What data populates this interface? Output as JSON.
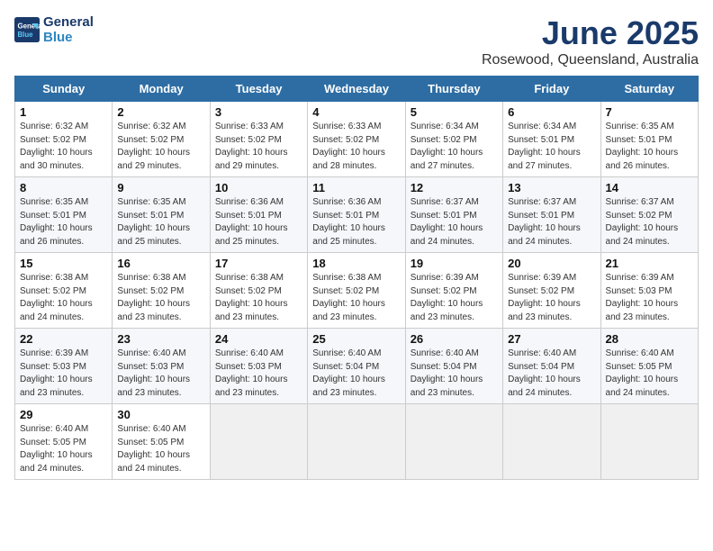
{
  "header": {
    "logo_line1": "General",
    "logo_line2": "Blue",
    "month": "June 2025",
    "location": "Rosewood, Queensland, Australia"
  },
  "weekdays": [
    "Sunday",
    "Monday",
    "Tuesday",
    "Wednesday",
    "Thursday",
    "Friday",
    "Saturday"
  ],
  "weeks": [
    [
      {
        "day": "1",
        "detail": "Sunrise: 6:32 AM\nSunset: 5:02 PM\nDaylight: 10 hours\nand 30 minutes."
      },
      {
        "day": "2",
        "detail": "Sunrise: 6:32 AM\nSunset: 5:02 PM\nDaylight: 10 hours\nand 29 minutes."
      },
      {
        "day": "3",
        "detail": "Sunrise: 6:33 AM\nSunset: 5:02 PM\nDaylight: 10 hours\nand 29 minutes."
      },
      {
        "day": "4",
        "detail": "Sunrise: 6:33 AM\nSunset: 5:02 PM\nDaylight: 10 hours\nand 28 minutes."
      },
      {
        "day": "5",
        "detail": "Sunrise: 6:34 AM\nSunset: 5:02 PM\nDaylight: 10 hours\nand 27 minutes."
      },
      {
        "day": "6",
        "detail": "Sunrise: 6:34 AM\nSunset: 5:01 PM\nDaylight: 10 hours\nand 27 minutes."
      },
      {
        "day": "7",
        "detail": "Sunrise: 6:35 AM\nSunset: 5:01 PM\nDaylight: 10 hours\nand 26 minutes."
      }
    ],
    [
      {
        "day": "8",
        "detail": "Sunrise: 6:35 AM\nSunset: 5:01 PM\nDaylight: 10 hours\nand 26 minutes."
      },
      {
        "day": "9",
        "detail": "Sunrise: 6:35 AM\nSunset: 5:01 PM\nDaylight: 10 hours\nand 25 minutes."
      },
      {
        "day": "10",
        "detail": "Sunrise: 6:36 AM\nSunset: 5:01 PM\nDaylight: 10 hours\nand 25 minutes."
      },
      {
        "day": "11",
        "detail": "Sunrise: 6:36 AM\nSunset: 5:01 PM\nDaylight: 10 hours\nand 25 minutes."
      },
      {
        "day": "12",
        "detail": "Sunrise: 6:37 AM\nSunset: 5:01 PM\nDaylight: 10 hours\nand 24 minutes."
      },
      {
        "day": "13",
        "detail": "Sunrise: 6:37 AM\nSunset: 5:01 PM\nDaylight: 10 hours\nand 24 minutes."
      },
      {
        "day": "14",
        "detail": "Sunrise: 6:37 AM\nSunset: 5:02 PM\nDaylight: 10 hours\nand 24 minutes."
      }
    ],
    [
      {
        "day": "15",
        "detail": "Sunrise: 6:38 AM\nSunset: 5:02 PM\nDaylight: 10 hours\nand 24 minutes."
      },
      {
        "day": "16",
        "detail": "Sunrise: 6:38 AM\nSunset: 5:02 PM\nDaylight: 10 hours\nand 23 minutes."
      },
      {
        "day": "17",
        "detail": "Sunrise: 6:38 AM\nSunset: 5:02 PM\nDaylight: 10 hours\nand 23 minutes."
      },
      {
        "day": "18",
        "detail": "Sunrise: 6:38 AM\nSunset: 5:02 PM\nDaylight: 10 hours\nand 23 minutes."
      },
      {
        "day": "19",
        "detail": "Sunrise: 6:39 AM\nSunset: 5:02 PM\nDaylight: 10 hours\nand 23 minutes."
      },
      {
        "day": "20",
        "detail": "Sunrise: 6:39 AM\nSunset: 5:02 PM\nDaylight: 10 hours\nand 23 minutes."
      },
      {
        "day": "21",
        "detail": "Sunrise: 6:39 AM\nSunset: 5:03 PM\nDaylight: 10 hours\nand 23 minutes."
      }
    ],
    [
      {
        "day": "22",
        "detail": "Sunrise: 6:39 AM\nSunset: 5:03 PM\nDaylight: 10 hours\nand 23 minutes."
      },
      {
        "day": "23",
        "detail": "Sunrise: 6:40 AM\nSunset: 5:03 PM\nDaylight: 10 hours\nand 23 minutes."
      },
      {
        "day": "24",
        "detail": "Sunrise: 6:40 AM\nSunset: 5:03 PM\nDaylight: 10 hours\nand 23 minutes."
      },
      {
        "day": "25",
        "detail": "Sunrise: 6:40 AM\nSunset: 5:04 PM\nDaylight: 10 hours\nand 23 minutes."
      },
      {
        "day": "26",
        "detail": "Sunrise: 6:40 AM\nSunset: 5:04 PM\nDaylight: 10 hours\nand 23 minutes."
      },
      {
        "day": "27",
        "detail": "Sunrise: 6:40 AM\nSunset: 5:04 PM\nDaylight: 10 hours\nand 24 minutes."
      },
      {
        "day": "28",
        "detail": "Sunrise: 6:40 AM\nSunset: 5:05 PM\nDaylight: 10 hours\nand 24 minutes."
      }
    ],
    [
      {
        "day": "29",
        "detail": "Sunrise: 6:40 AM\nSunset: 5:05 PM\nDaylight: 10 hours\nand 24 minutes."
      },
      {
        "day": "30",
        "detail": "Sunrise: 6:40 AM\nSunset: 5:05 PM\nDaylight: 10 hours\nand 24 minutes."
      },
      {
        "day": "",
        "detail": ""
      },
      {
        "day": "",
        "detail": ""
      },
      {
        "day": "",
        "detail": ""
      },
      {
        "day": "",
        "detail": ""
      },
      {
        "day": "",
        "detail": ""
      }
    ]
  ]
}
